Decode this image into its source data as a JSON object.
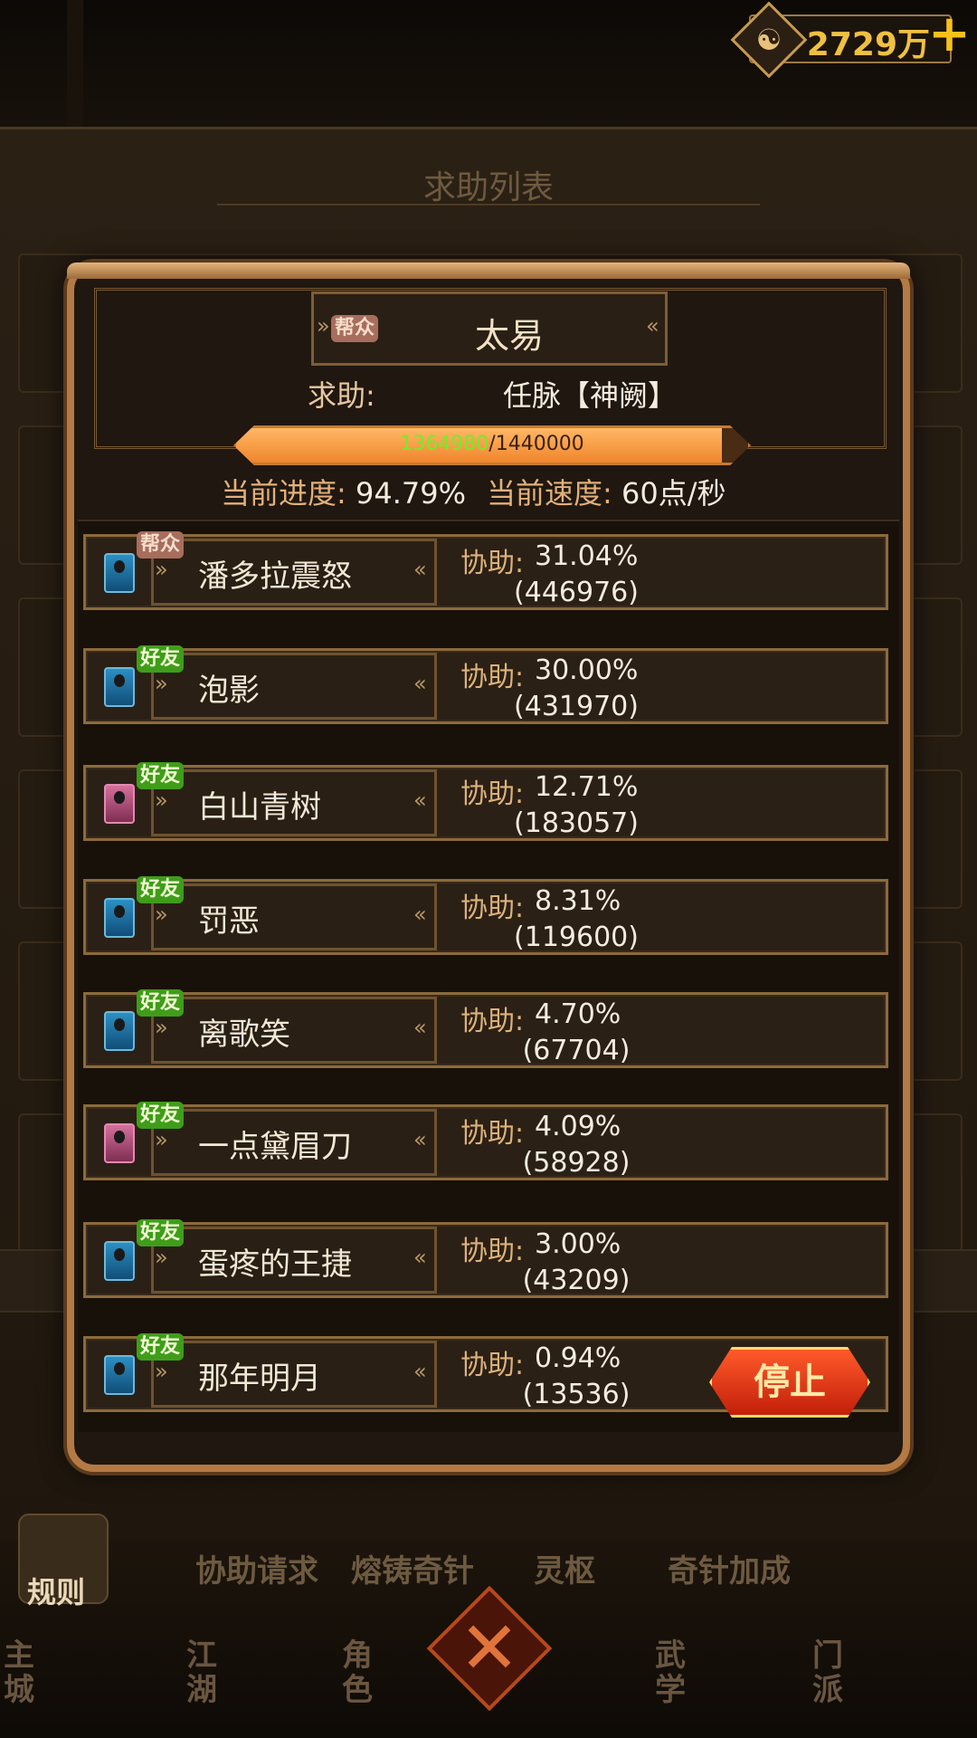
{
  "currency": {
    "value": "2729万",
    "icon": "taiji-coin-icon",
    "add_icon": "plus-icon"
  },
  "background": {
    "title": "求助列表",
    "tabs": [
      "协助请求",
      "熔铸奇针",
      "灵枢",
      "奇针加成"
    ],
    "rule_label": "规则",
    "nav": [
      "主城",
      "江湖",
      "角色",
      "武学",
      "门派"
    ]
  },
  "dialog": {
    "target": {
      "tag": "帮众",
      "name": "太易"
    },
    "request": {
      "label": "求助:",
      "value": "任脉【神阙】"
    },
    "progress": {
      "current": "1364980",
      "separator": "/",
      "max": "1440000",
      "fraction": 0.9479
    },
    "progress_label": "当前进度:",
    "progress_value": "94.79%",
    "speed_label": "当前速度:",
    "speed_value": "60点/秒",
    "assist_label": "协助:",
    "stop_button": "停止",
    "helpers": [
      {
        "tag": "帮众",
        "name": "潘多拉震怒",
        "percent": "31.04%",
        "points": "(446976)",
        "gender": "male"
      },
      {
        "tag": "好友",
        "name": "泡影",
        "percent": "30.00%",
        "points": "(431970)",
        "gender": "male"
      },
      {
        "tag": "好友",
        "name": "白山青树",
        "percent": "12.71%",
        "points": "(183057)",
        "gender": "female"
      },
      {
        "tag": "好友",
        "name": "罚恶",
        "percent": "8.31%",
        "points": "(119600)",
        "gender": "male"
      },
      {
        "tag": "好友",
        "name": "离歌笑",
        "percent": "4.70%",
        "points": "(67704)",
        "gender": "male"
      },
      {
        "tag": "好友",
        "name": "一点黛眉刀",
        "percent": "4.09%",
        "points": "(58928)",
        "gender": "female"
      },
      {
        "tag": "好友",
        "name": "蛋疼的王捷",
        "percent": "3.00%",
        "points": "(43209)",
        "gender": "male"
      },
      {
        "tag": "好友",
        "name": "那年明月",
        "percent": "0.94%",
        "points": "(13536)",
        "gender": "male"
      }
    ]
  },
  "colors": {
    "accent": "#b57a44",
    "friend_tag": "#3f9d1a",
    "guild_tag": "#a86d5c",
    "progress_fill": "#f0852c",
    "stop_button": "#c21f0a"
  }
}
